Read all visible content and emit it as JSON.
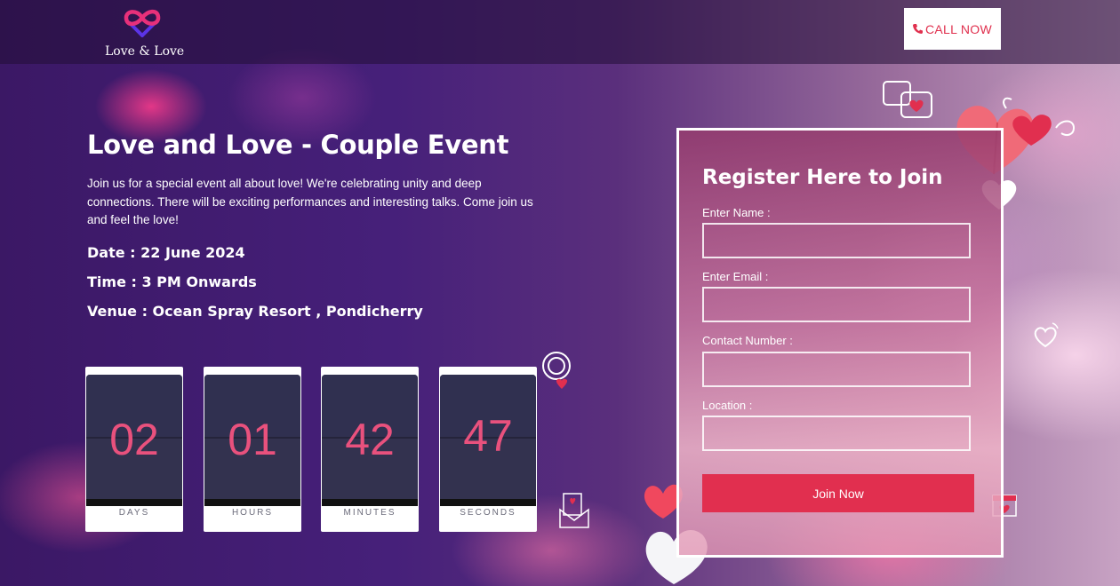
{
  "header": {
    "logo_text": "Love & Love",
    "call_button_label": "CALL NOW"
  },
  "event": {
    "title": "Love and Love - Couple Event",
    "description": "Join us for a special event all about love! We're celebrating unity and deep connections. There will be exciting performances and interesting talks. Come join us and feel the love!",
    "date": "Date : 22 June 2024",
    "time": "Time : 3 PM Onwards",
    "venue": "Venue : Ocean Spray Resort , Pondicherry"
  },
  "countdown": [
    {
      "value": "02",
      "label": "DAYS"
    },
    {
      "value": "01",
      "label": "HOURS"
    },
    {
      "value": "42",
      "label": "MINUTES"
    },
    {
      "value": "47",
      "label": "SECONDS"
    }
  ],
  "form": {
    "title": "Register Here to Join",
    "fields": [
      {
        "label": "Enter Name :",
        "value": ""
      },
      {
        "label": "Enter Email :",
        "value": ""
      },
      {
        "label": "Contact Number :",
        "value": ""
      },
      {
        "label": "Location :",
        "value": ""
      }
    ],
    "submit_label": "Join Now"
  },
  "colors": {
    "accent": "#e12f4f",
    "counter_digits": "#e9517d",
    "logo_pink": "#e8307a",
    "logo_blue": "#5b34e6"
  }
}
